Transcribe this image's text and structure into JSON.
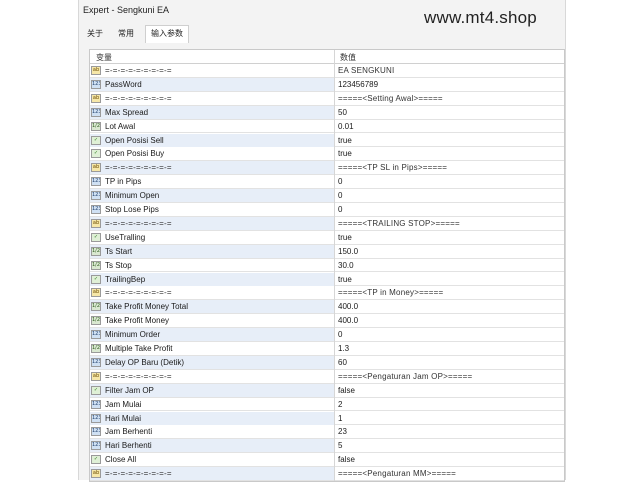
{
  "window": {
    "title": "Expert - Sengkuni EA"
  },
  "watermark": "www.mt4.shop",
  "tabs": [
    {
      "label": "关于"
    },
    {
      "label": "常用"
    },
    {
      "label": "输入参数"
    }
  ],
  "grid": {
    "col_variable": "变量",
    "col_value": "数值",
    "rows": [
      {
        "icon": "string-type-icon",
        "type": "str",
        "name": "=-=-=-=-=-=-=-=-=",
        "value": "EA SENGKUNI"
      },
      {
        "icon": "int-type-icon",
        "type": "int",
        "name": "PassWord",
        "value": "123456789"
      },
      {
        "icon": "string-type-icon",
        "type": "str",
        "name": "=-=-=-=-=-=-=-=-=",
        "value": "=====<Setting Awal>====="
      },
      {
        "icon": "int-type-icon",
        "type": "int",
        "name": "Max Spread",
        "value": "50"
      },
      {
        "icon": "double-type-icon",
        "type": "dbl",
        "name": "Lot Awal",
        "value": "0.01"
      },
      {
        "icon": "bool-type-icon",
        "type": "bool",
        "name": "Open Posisi Sell",
        "value": "true"
      },
      {
        "icon": "bool-type-icon",
        "type": "bool",
        "name": "Open Posisi Buy",
        "value": "true"
      },
      {
        "icon": "string-type-icon",
        "type": "str",
        "name": "=-=-=-=-=-=-=-=-=",
        "value": "=====<TP SL in Pips>====="
      },
      {
        "icon": "int-type-icon",
        "type": "int",
        "name": "TP in Pips",
        "value": "0"
      },
      {
        "icon": "int-type-icon",
        "type": "int",
        "name": "Minimum Open",
        "value": "0"
      },
      {
        "icon": "int-type-icon",
        "type": "int",
        "name": "Stop Lose Pips",
        "value": "0"
      },
      {
        "icon": "string-type-icon",
        "type": "str",
        "name": "=-=-=-=-=-=-=-=-=",
        "value": "=====<TRAILING STOP>====="
      },
      {
        "icon": "bool-type-icon",
        "type": "bool",
        "name": "UseTralling",
        "value": "true"
      },
      {
        "icon": "double-type-icon",
        "type": "dbl",
        "name": "Ts Start",
        "value": "150.0"
      },
      {
        "icon": "double-type-icon",
        "type": "dbl",
        "name": "Ts Stop",
        "value": "30.0"
      },
      {
        "icon": "bool-type-icon",
        "type": "bool",
        "name": "TrailingBep",
        "value": "true"
      },
      {
        "icon": "string-type-icon",
        "type": "str",
        "name": "=-=-=-=-=-=-=-=-=",
        "value": "=====<TP in Money>====="
      },
      {
        "icon": "double-type-icon",
        "type": "dbl",
        "name": "Take Profit Money Total",
        "value": "400.0"
      },
      {
        "icon": "double-type-icon",
        "type": "dbl",
        "name": "Take Profit Money",
        "value": "400.0"
      },
      {
        "icon": "int-type-icon",
        "type": "int",
        "name": "Minimum Order",
        "value": "0"
      },
      {
        "icon": "double-type-icon",
        "type": "dbl",
        "name": "Multiple Take Profit",
        "value": "1.3"
      },
      {
        "icon": "int-type-icon",
        "type": "int",
        "name": "Delay OP Baru (Detik)",
        "value": "60"
      },
      {
        "icon": "string-type-icon",
        "type": "str",
        "name": "=-=-=-=-=-=-=-=-=",
        "value": "=====<Pengaturan Jam OP>====="
      },
      {
        "icon": "bool-type-icon",
        "type": "bool",
        "name": "Filter Jam OP",
        "value": "false"
      },
      {
        "icon": "int-type-icon",
        "type": "int",
        "name": "Jam Mulai",
        "value": "2"
      },
      {
        "icon": "int-type-icon",
        "type": "int",
        "name": "Hari Mulai",
        "value": "1"
      },
      {
        "icon": "int-type-icon",
        "type": "int",
        "name": "Jam Berhenti",
        "value": "23"
      },
      {
        "icon": "int-type-icon",
        "type": "int",
        "name": "Hari Berhenti",
        "value": "5"
      },
      {
        "icon": "bool-type-icon",
        "type": "bool",
        "name": "Close All",
        "value": "false"
      },
      {
        "icon": "string-type-icon",
        "type": "str",
        "name": "=-=-=-=-=-=-=-=-=",
        "value": "=====<Pengaturan MM>====="
      }
    ]
  }
}
